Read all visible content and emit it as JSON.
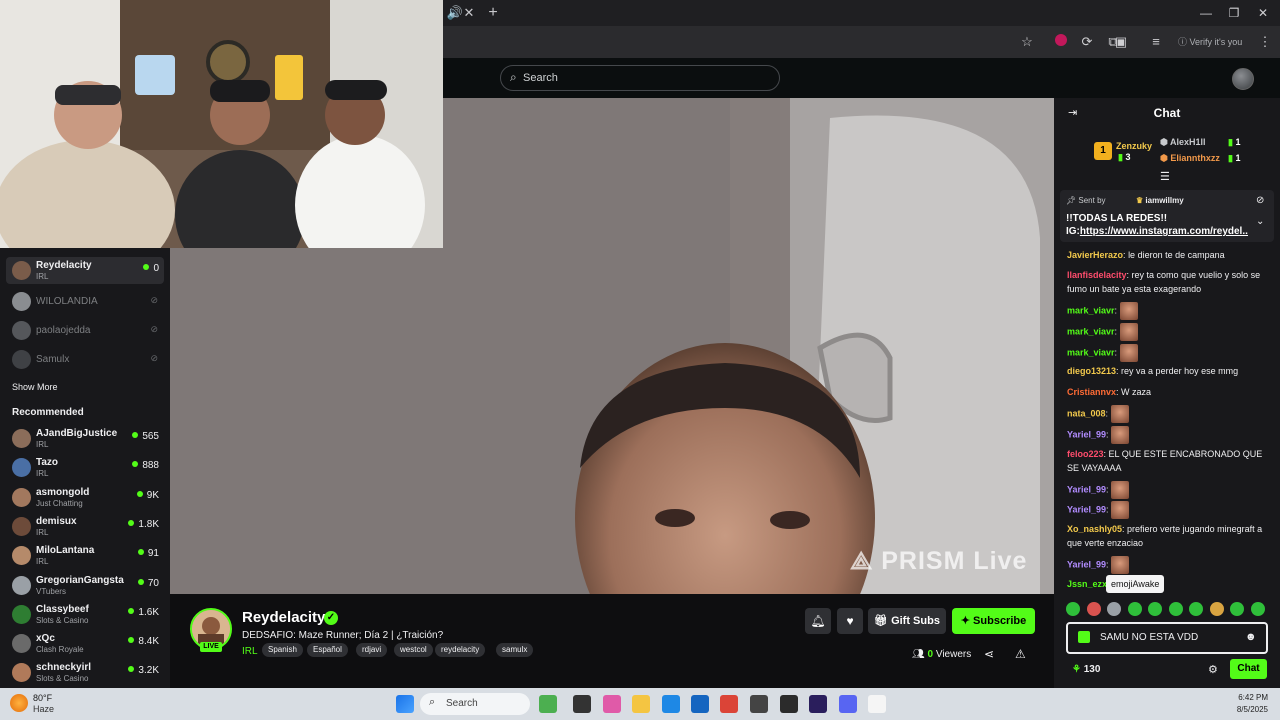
{
  "browser": {
    "profile_label": "Verify it's you"
  },
  "header": {
    "search_placeholder": "Search"
  },
  "sidebar": {
    "followed": [
      {
        "name": "Reydelacity",
        "category": "IRL",
        "viewers": "0",
        "live": true,
        "active": true
      },
      {
        "name": "WILOLANDIA",
        "live": false
      },
      {
        "name": "paolaojedda",
        "live": false
      },
      {
        "name": "Samulx",
        "live": false
      }
    ],
    "show_more": "Show More",
    "recommended_title": "Recommended",
    "recommended": [
      {
        "name": "AJandBigJustice",
        "category": "IRL",
        "viewers": "565"
      },
      {
        "name": "Tazo",
        "category": "IRL",
        "viewers": "888"
      },
      {
        "name": "asmongold",
        "category": "Just Chatting",
        "viewers": "9K"
      },
      {
        "name": "demisux",
        "category": "IRL",
        "viewers": "1.8K"
      },
      {
        "name": "MiloLantana",
        "category": "IRL",
        "viewers": "91"
      },
      {
        "name": "GregorianGangsta",
        "category": "VTubers",
        "viewers": "70"
      },
      {
        "name": "Classybeef",
        "category": "Slots & Casino",
        "viewers": "1.6K"
      },
      {
        "name": "xQc",
        "category": "Clash Royale",
        "viewers": "8.4K"
      },
      {
        "name": "schneckyirl",
        "category": "Slots & Casino",
        "viewers": "3.2K"
      }
    ]
  },
  "video": {
    "watermark": "PRISM Live"
  },
  "stream": {
    "streamer": "Reydelacity",
    "live_label": "LIVE",
    "title": "DEDSAFIO: Maze Runner; Día 2 | ¿Traición?",
    "category": "IRL",
    "tags": [
      "Spanish",
      "Español",
      "rdjavi",
      "westcol",
      "reydelacity",
      "samulx"
    ],
    "gift_label": "Gift Subs",
    "subscribe_label": "Subscribe",
    "viewers_count": "0",
    "viewers_label": "Viewers"
  },
  "chat": {
    "title": "Chat",
    "leaderboard": [
      {
        "rank": "1",
        "name": "Zenzuky",
        "count": "3"
      },
      {
        "name": "AlexH1ll",
        "count": "1"
      },
      {
        "name": "Eliannthxzz",
        "count": "1"
      }
    ],
    "pinned": {
      "sent_by": "Sent by",
      "user": "iamwillmy",
      "line1": "!!TODAS LA REDES!!",
      "line2_prefix": "IG:",
      "line2_link": "https://www.instagram.com/reydel..."
    },
    "messages": [
      {
        "user": "JavierHerazo",
        "color": "#f2c94c",
        "text": "le dieron te de campana"
      },
      {
        "user": "llanfisdelacity",
        "color": "#ff4d6d",
        "text": "rey ta como que vuelio y solo se fumo un bate ya esta exagerando"
      },
      {
        "user": "mark_viavr",
        "color": "#53fc18",
        "text": "",
        "emote": true
      },
      {
        "user": "mark_viavr",
        "color": "#53fc18",
        "text": "",
        "emote": true
      },
      {
        "user": "mark_viavr",
        "color": "#53fc18",
        "text": "",
        "emote": true
      },
      {
        "user": "diego13213",
        "color": "#f2c94c",
        "text": "rey va a perder hoy ese mmg"
      },
      {
        "user": "Cristiannvx",
        "color": "#ff6b35",
        "text": "W zaza"
      },
      {
        "user": "nata_008",
        "color": "#f2c94c",
        "text": "",
        "emote": true
      },
      {
        "user": "Yariel_99",
        "color": "#b18cff",
        "text": "",
        "emote": true
      },
      {
        "user": "feloo223",
        "color": "#ff4d6d",
        "text": "EL QUE ESTE ENCABRONADO QUE SE VAYAAAA"
      },
      {
        "user": "Yariel_99",
        "color": "#b18cff",
        "text": "",
        "emote": true
      },
      {
        "user": "Yariel_99",
        "color": "#b18cff",
        "text": "",
        "emote": true
      },
      {
        "user": "Xo_nashly05",
        "color": "#f2c94c",
        "text": "prefiero verte jugando minegraft a que verte enzaciao"
      },
      {
        "user": "Yariel_99",
        "color": "#b18cff",
        "text": "",
        "emote": true
      },
      {
        "user": "Jssn_ezx",
        "color": "#53fc18",
        "text": ""
      }
    ],
    "tooltip": "emojiAwake",
    "input_value": "SAMU NO ESTA VDD",
    "points": "130",
    "send_label": "Chat"
  },
  "taskbar": {
    "weather_temp": "80°F",
    "weather_desc": "Haze",
    "search_label": "Search",
    "time": "6:42 PM",
    "date": "8/5/2025"
  },
  "colors": {
    "accent": "#53fc18",
    "background": "#0e0e10",
    "panel": "#18181b"
  }
}
